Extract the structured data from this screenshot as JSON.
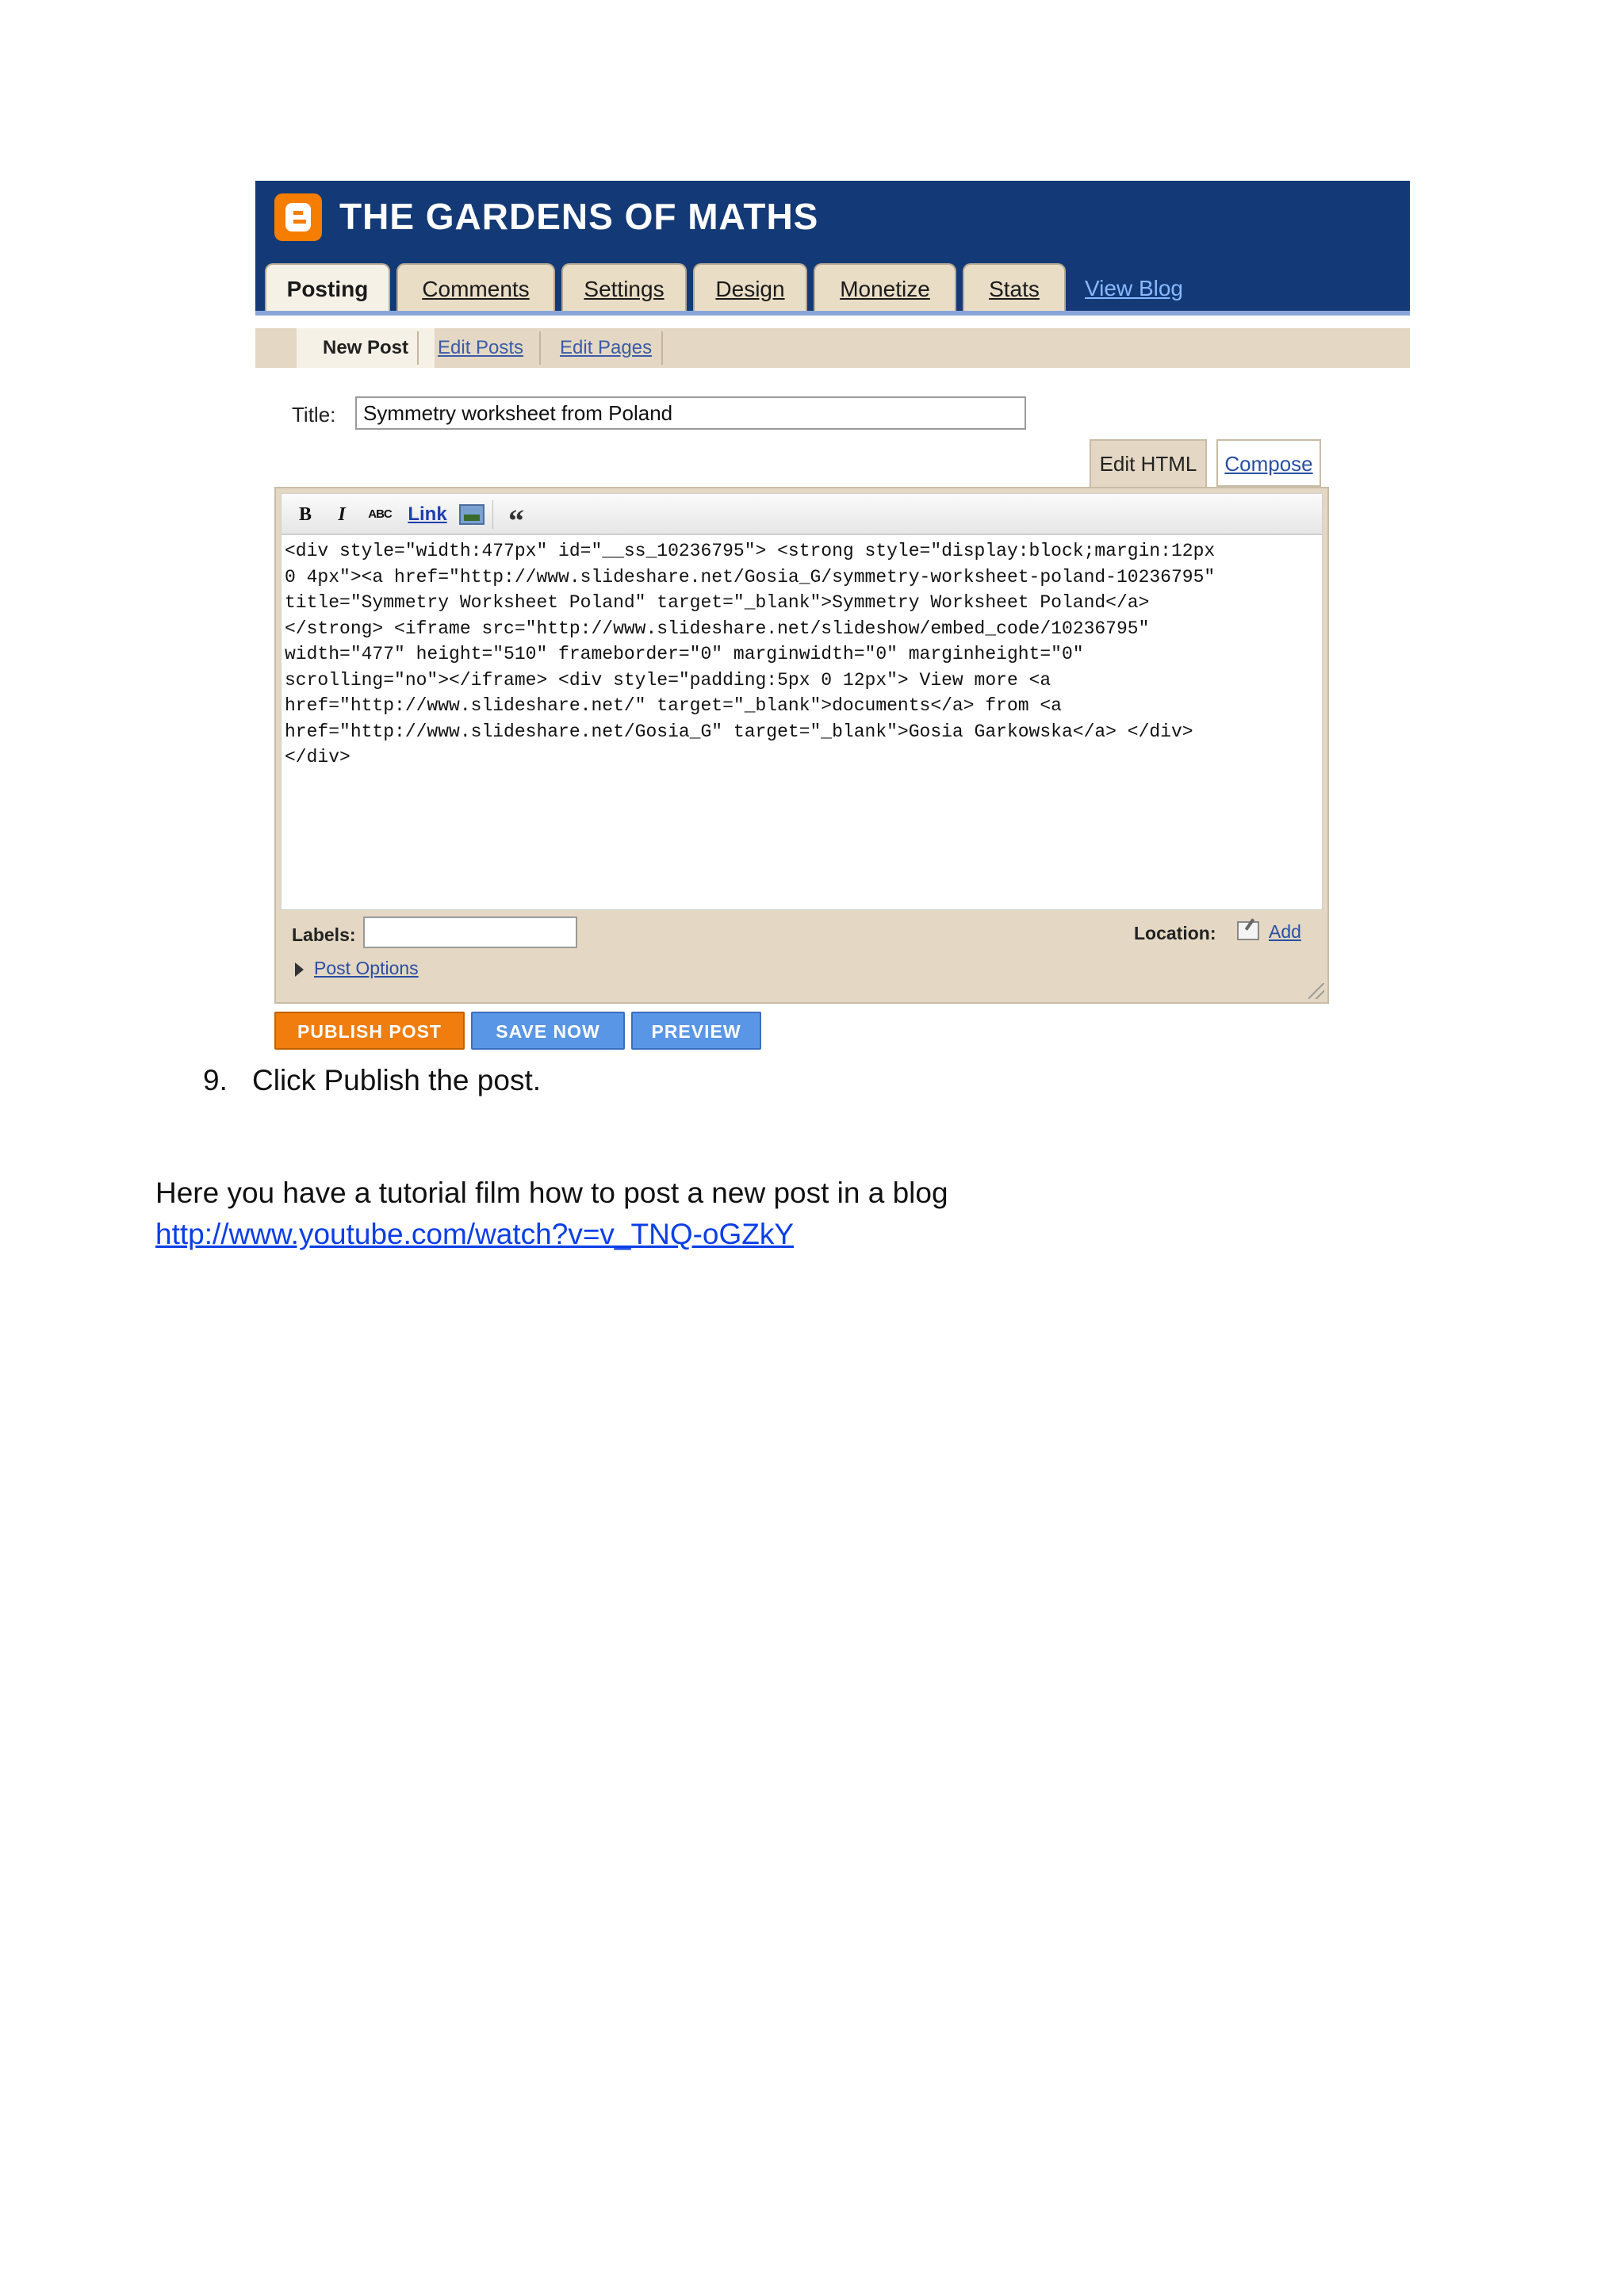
{
  "header": {
    "blog_title": "THE GARDENS OF MATHS",
    "tabs": [
      {
        "label": "Posting",
        "active": true
      },
      {
        "label": "Comments",
        "active": false
      },
      {
        "label": "Settings",
        "active": false
      },
      {
        "label": "Design",
        "active": false
      },
      {
        "label": "Monetize",
        "active": false
      },
      {
        "label": "Stats",
        "active": false
      }
    ],
    "view_blog": "View Blog"
  },
  "subnav": {
    "current": "New Post",
    "links": [
      "Edit Posts",
      "Edit Pages"
    ]
  },
  "post": {
    "title_label": "Title:",
    "title_value": "Symmetry worksheet from Poland",
    "mode_tabs": {
      "edit_html": "Edit HTML",
      "compose": "Compose"
    },
    "toolbar": {
      "bold": "B",
      "italic": "I",
      "spellcheck": "ABC",
      "link": "Link",
      "quote": "“"
    },
    "html_lines": [
      "<div style=\"width:477px\" id=\"__ss_10236795\"> <strong style=\"display:block;margin:12px",
      "0 4px\"><a href=\"http://www.slideshare.net/Gosia_G/symmetry-worksheet-poland-10236795\"",
      "title=\"Symmetry Worksheet Poland\" target=\"_blank\">Symmetry Worksheet Poland</a>",
      "</strong> <iframe src=\"http://www.slideshare.net/slideshow/embed_code/10236795\"",
      "width=\"477\" height=\"510\" frameborder=\"0\" marginwidth=\"0\" marginheight=\"0\"",
      "scrolling=\"no\"></iframe> <div style=\"padding:5px 0 12px\"> View more <a",
      "href=\"http://www.slideshare.net/\" target=\"_blank\">documents</a> from <a",
      "href=\"http://www.slideshare.net/Gosia_G\" target=\"_blank\">Gosia Garkowska</a> </div>",
      "</div>"
    ],
    "labels_label": "Labels:",
    "labels_value": "",
    "location_label": "Location:",
    "location_add": "Add",
    "post_options": "Post Options"
  },
  "actions": {
    "publish": "PUBLISH POST",
    "save": "SAVE NOW",
    "preview": "PREVIEW"
  },
  "document": {
    "step_number": "9.",
    "step_text": "Click Publish the post.",
    "paragraph": "Here you have a tutorial film how to post a new post in a blog",
    "url": "http://www.youtube.com/watch?v=v_TNQ-oGZkY"
  },
  "colors": {
    "header_blue": "#133a76",
    "blogger_orange": "#f57d00",
    "tab_beige": "#e9ddc6",
    "button_blue": "#5a96e6",
    "link_blue": "#0b3ee6"
  }
}
